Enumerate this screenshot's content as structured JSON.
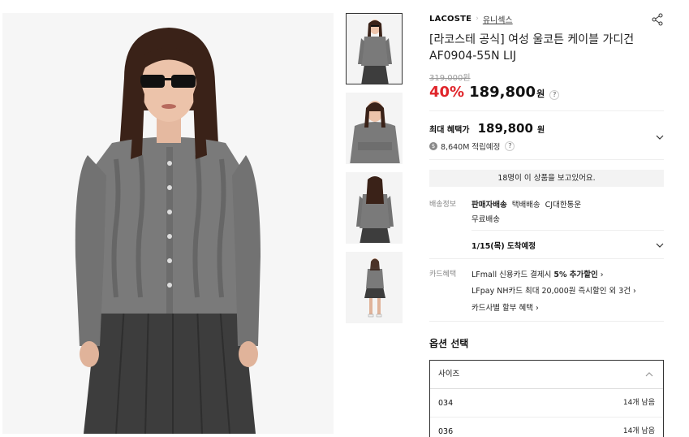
{
  "product": {
    "brand": "LACOSTE",
    "category": "유니섹스",
    "title_line1": "[라코스테 공식] 여성 울코튼 케이블 가디건",
    "title_line2": "AF0904-55N LIJ",
    "original_price": "319,000원",
    "discount": "40%",
    "price": "189,800",
    "currency": "원"
  },
  "benefit": {
    "label": "최대 혜택가",
    "price": "189,800",
    "currency": "원",
    "points": "8,640M 적립예정"
  },
  "viewers_text": "18명이 이 상품을 보고있어요.",
  "shipping": {
    "label": "배송정보",
    "type1": "판매자배송",
    "type2": "택배배송",
    "carrier": "CJ대한통운",
    "fee": "무료배송",
    "arrival": "1/15(목) 도착예정"
  },
  "card": {
    "label": "카드혜택",
    "line1_pre": "LFmall 신용카드 결제시 ",
    "line1_bold": "5% 추가할인",
    "line1_arrow": " ›",
    "line2": "LFpay NH카드 최대 20,000원 즉시할인 외 3건  ›",
    "line3": "카드사별 할부 혜택  ›"
  },
  "options": {
    "title": "옵션 선택",
    "select_label": "사이즈",
    "items": [
      {
        "size": "034",
        "stock": "14개 남음"
      },
      {
        "size": "036",
        "stock": "14개 남음"
      }
    ]
  },
  "icons": {
    "share": "share-icon",
    "chevron": "chevron-down-icon",
    "question": "question-icon"
  },
  "colors": {
    "discount": "#e0242a",
    "sweater": "#7a7a7a",
    "skirt": "#3d3d3d"
  }
}
